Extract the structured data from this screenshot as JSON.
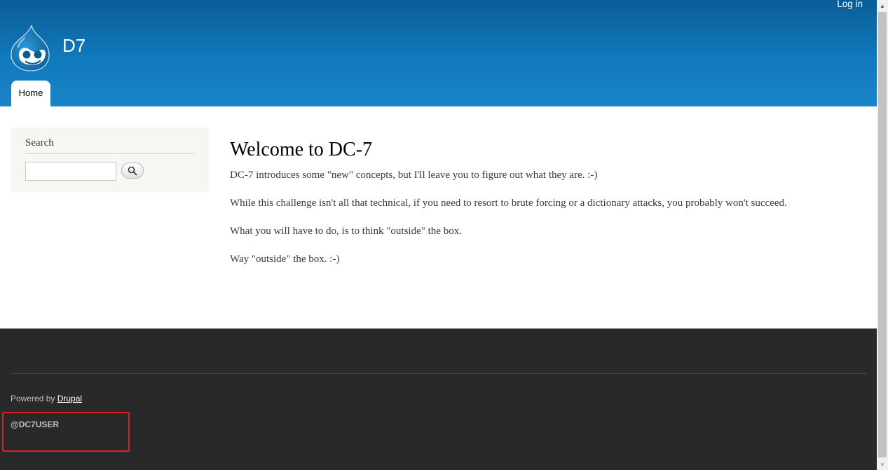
{
  "header": {
    "login_label": "Log in",
    "site_name": "D7",
    "tabs": [
      {
        "label": "Home"
      }
    ],
    "brand_color": "#1179bd"
  },
  "sidebar": {
    "search": {
      "title": "Search",
      "input_value": "",
      "button_icon": "search-icon"
    }
  },
  "main": {
    "title": "Welcome to DC-7",
    "paragraphs": [
      "DC-7 introduces some \"new\" concepts, but I'll leave you to figure out what they are.  :-)",
      "While this challenge isn't all that technical, if you need to resort to brute forcing or a dictionary attacks, you probably won't succeed.",
      "What you will have to do, is to think \"outside\" the box.",
      "Way \"outside\" the box.  :-)"
    ]
  },
  "footer": {
    "powered_by_prefix": "Powered by",
    "powered_by_link": "Drupal",
    "user_handle": "@DC7USER",
    "background_color": "#292929",
    "highlight_color": "#e02020"
  }
}
